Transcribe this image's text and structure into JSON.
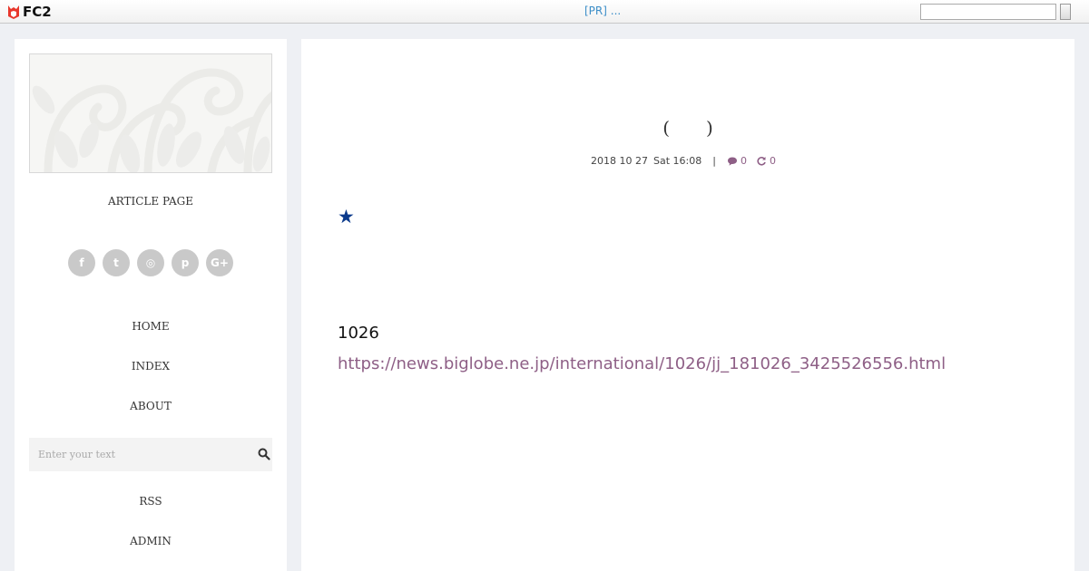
{
  "topbar": {
    "logo_text": "FC2",
    "pr_text": "[PR] ...",
    "search_value": ""
  },
  "sidebar": {
    "blog_title": "ARTICLE PAGE",
    "socials": [
      {
        "icon": "facebook-icon",
        "glyph": "f"
      },
      {
        "icon": "twitter-icon",
        "glyph": "t"
      },
      {
        "icon": "instagram-icon",
        "glyph": "◎"
      },
      {
        "icon": "pinterest-icon",
        "glyph": "p"
      },
      {
        "icon": "google-plus-icon",
        "glyph": "G+"
      }
    ],
    "nav": [
      "HOME",
      "INDEX",
      "ABOUT"
    ],
    "search_placeholder": "Enter your text",
    "nav_bottom": [
      "RSS",
      "ADMIN"
    ]
  },
  "post": {
    "title": "(　　)",
    "date": "2018 10 27",
    "time": "Sat 16:08",
    "separator": "|",
    "comments": "0",
    "trackbacks": "0",
    "star": "★",
    "body_text": "1026",
    "link": "https://news.biglobe.ne.jp/international/1026/jj_181026_3425526556.html"
  },
  "colors": {
    "accent": "#8e5f86",
    "pr_link": "#3c8ec8",
    "star": "#0b3a8c"
  }
}
